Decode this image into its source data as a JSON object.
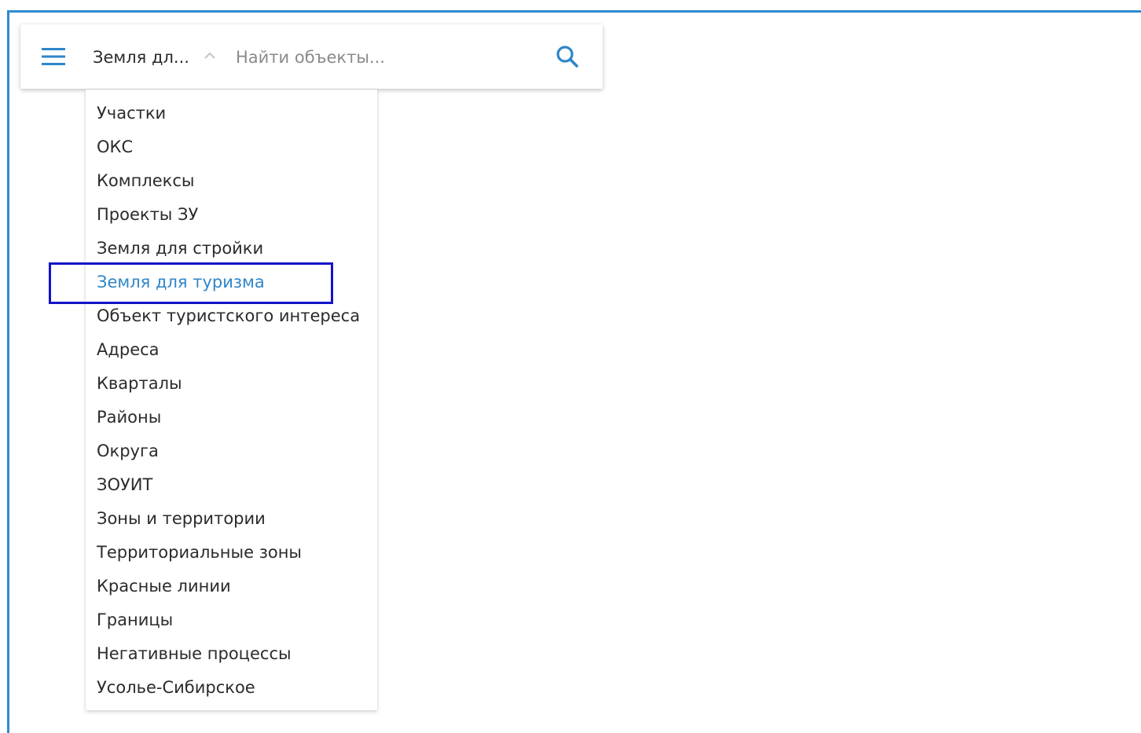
{
  "search_bar": {
    "layer_selected": "Земля дл...",
    "search_placeholder": "Найти объекты...",
    "search_value": ""
  },
  "dropdown": {
    "items": [
      {
        "label": "Участки"
      },
      {
        "label": "ОКС"
      },
      {
        "label": "Комплексы"
      },
      {
        "label": "Проекты ЗУ"
      },
      {
        "label": "Земля для стройки"
      },
      {
        "label": "Земля для туризма",
        "selected": true
      },
      {
        "label": "Объект туристского интереса"
      },
      {
        "label": "Адреса"
      },
      {
        "label": "Кварталы"
      },
      {
        "label": "Районы"
      },
      {
        "label": "Округа"
      },
      {
        "label": "ЗОУИТ"
      },
      {
        "label": "Зоны и территории"
      },
      {
        "label": "Территориальные зоны"
      },
      {
        "label": "Красные линии"
      },
      {
        "label": "Границы"
      },
      {
        "label": "Негативные процессы"
      },
      {
        "label": "Усолье-Сибирское"
      }
    ]
  },
  "colors": {
    "accent": "#2f86c9",
    "frame_border": "#2f8ad0",
    "highlight_border": "#1414c8",
    "text": "#2b2b2b",
    "placeholder": "#8a8a8a"
  },
  "icons": {
    "menu": "hamburger-menu-icon",
    "chevron": "chevron-up-icon",
    "search": "search-icon"
  }
}
